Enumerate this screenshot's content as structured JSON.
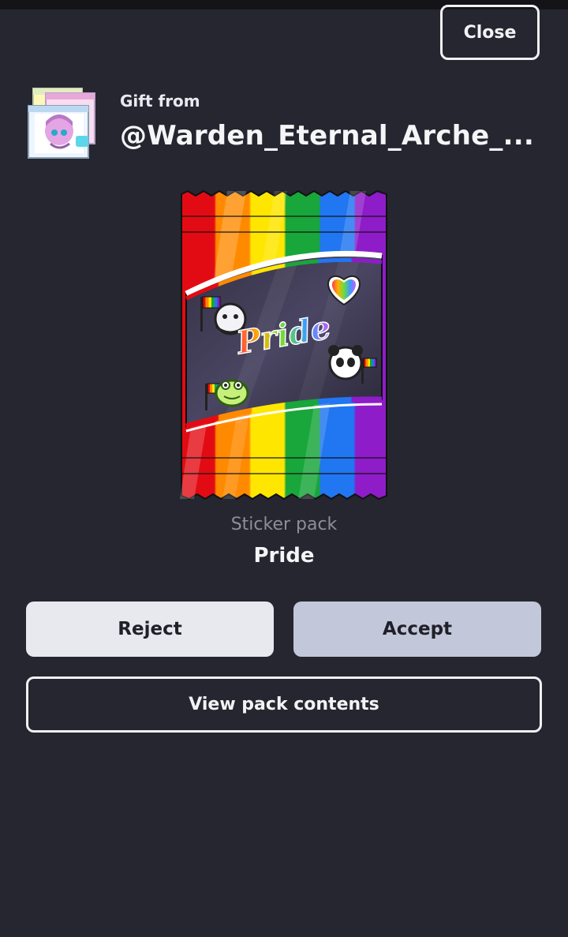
{
  "header": {
    "close_label": "Close"
  },
  "gift": {
    "from_label": "Gift from",
    "username": "@Warden_Eternal_Arche_..."
  },
  "pack": {
    "art_text": "Pride",
    "type_label": "Sticker pack",
    "name": "Pride",
    "icons": [
      "rainbow-heart-sticker-icon",
      "ghost-flag-sticker-icon",
      "panda-flag-sticker-icon",
      "frog-flag-sticker-icon"
    ]
  },
  "actions": {
    "reject_label": "Reject",
    "accept_label": "Accept",
    "view_contents_label": "View pack contents"
  },
  "colors": {
    "background": "#262630",
    "accept_bg": "#c2c8d9",
    "reject_bg": "#e8e8ef",
    "rainbow": [
      "#e30b13",
      "#ff8a00",
      "#ffe600",
      "#19a63a",
      "#2176f2",
      "#8e1cc9"
    ]
  }
}
